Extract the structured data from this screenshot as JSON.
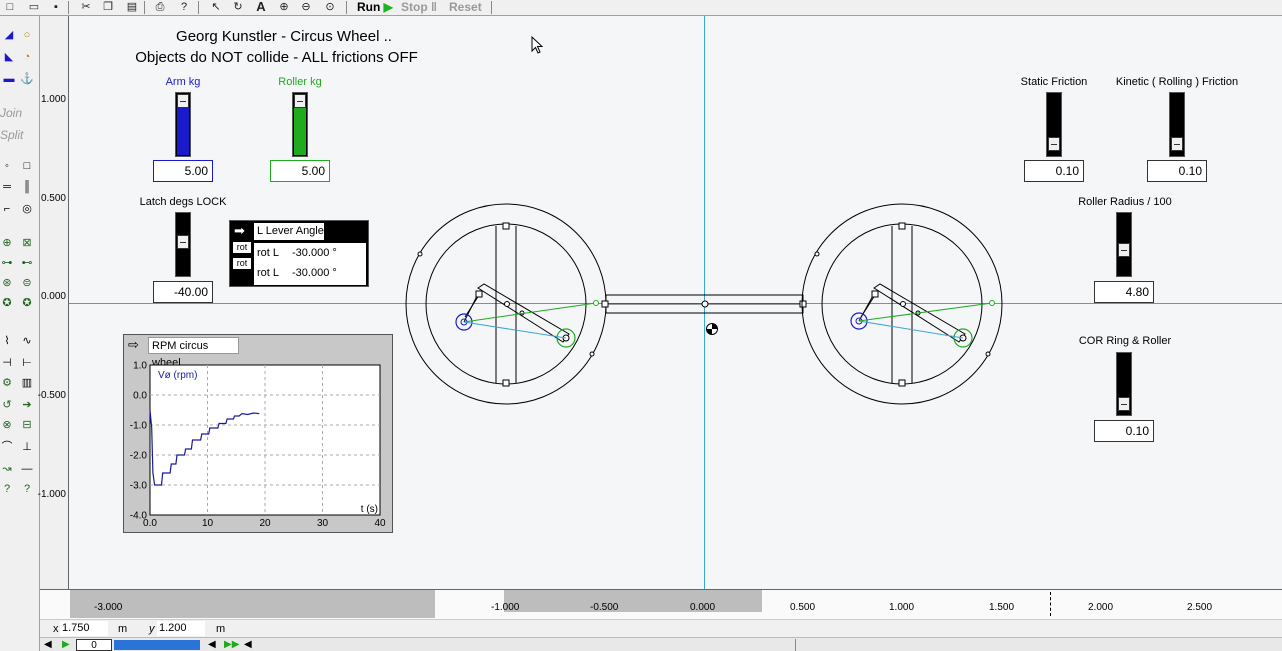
{
  "toolbar": {
    "run_label": "Run",
    "stop_label": "Stop",
    "reset_label": "Reset",
    "colors": {
      "run": "#000000",
      "run_arrow": "#1db51d",
      "disabled": "#9a9a9a"
    }
  },
  "palette": {
    "join_label": "Join",
    "split_label": "Split"
  },
  "canvas": {
    "title_line1": "Georg Kunstler - Circus Wheel ..",
    "title_line2": "Objects do NOT collide - ALL frictions OFF"
  },
  "controls": {
    "arm_kg": {
      "label": "Arm kg",
      "value": "5.00",
      "color": "#1a1acc",
      "level": 0.78
    },
    "roller_kg": {
      "label": "Roller kg",
      "value": "5.00",
      "color": "#1faa1f",
      "level": 0.78
    },
    "latch": {
      "label": "Latch degs LOCK",
      "value": "-40.00"
    },
    "static_friction": {
      "label": "Static Friction",
      "value": "0.10"
    },
    "kinetic_friction": {
      "label": "Kinetic ( Rolling ) Friction",
      "value": "0.10"
    },
    "roller_radius": {
      "label": "Roller Radius / 100",
      "value": "4.80"
    },
    "cor": {
      "label": "COR Ring & Roller",
      "value": "0.10"
    }
  },
  "meter": {
    "title": "L Lever Angle",
    "rows": [
      {
        "tag": "rot",
        "label": "rot L",
        "value": "-30.000 °"
      },
      {
        "tag": "rot",
        "label": "rot L",
        "value": "-30.000 °"
      }
    ]
  },
  "graph_title": "RPM circus wheel",
  "chart_data": {
    "type": "line",
    "series": [
      {
        "name": "Vø (rpm)",
        "x": [
          0,
          0.3,
          0.5,
          0.8,
          1.2,
          2,
          2.2,
          2.6,
          3.5,
          3.7,
          4.5,
          4.7,
          6,
          6.2,
          7.2,
          7.4,
          8.8,
          9,
          10.2,
          10.4,
          11.8,
          12,
          13.2,
          13.4,
          14.5,
          14.7,
          15.5,
          16,
          17,
          18,
          19
        ],
        "y": [
          -0.5,
          -1.1,
          -2.6,
          -3.0,
          -3.0,
          -3.0,
          -2.6,
          -2.6,
          -2.6,
          -2.3,
          -2.3,
          -2.0,
          -2.0,
          -1.8,
          -1.8,
          -1.5,
          -1.5,
          -1.3,
          -1.3,
          -1.1,
          -1.1,
          -0.95,
          -0.95,
          -0.8,
          -0.8,
          -0.7,
          -0.7,
          -0.62,
          -0.65,
          -0.6,
          -0.62
        ]
      }
    ],
    "ylabel": "Vø (rpm)",
    "xlabel": "t (s)",
    "xlim": [
      0,
      40
    ],
    "ylim": [
      -4.0,
      1.0
    ],
    "x_ticks": [
      "0.0",
      "10",
      "20",
      "30",
      "40"
    ],
    "y_ticks": [
      "1.0",
      "0.0",
      "-1.0",
      "-2.0",
      "-3.0",
      "-4.0"
    ],
    "grid": true,
    "line_color": "#1a1a99"
  },
  "rulers": {
    "vertical": [
      "1.000",
      "0.500",
      "0.000",
      "-0.500",
      "-1.000"
    ],
    "horizontal": [
      "-3.000",
      "-1.000",
      "-0.500",
      "0.000",
      "0.500",
      "1.000",
      "1.500",
      "2.000",
      "2.500"
    ]
  },
  "status": {
    "x_label": "x",
    "x_value": "1.750",
    "x_unit": "m",
    "y_label": "y",
    "y_value": "1.200",
    "y_unit": "m",
    "frame_value": "0"
  }
}
